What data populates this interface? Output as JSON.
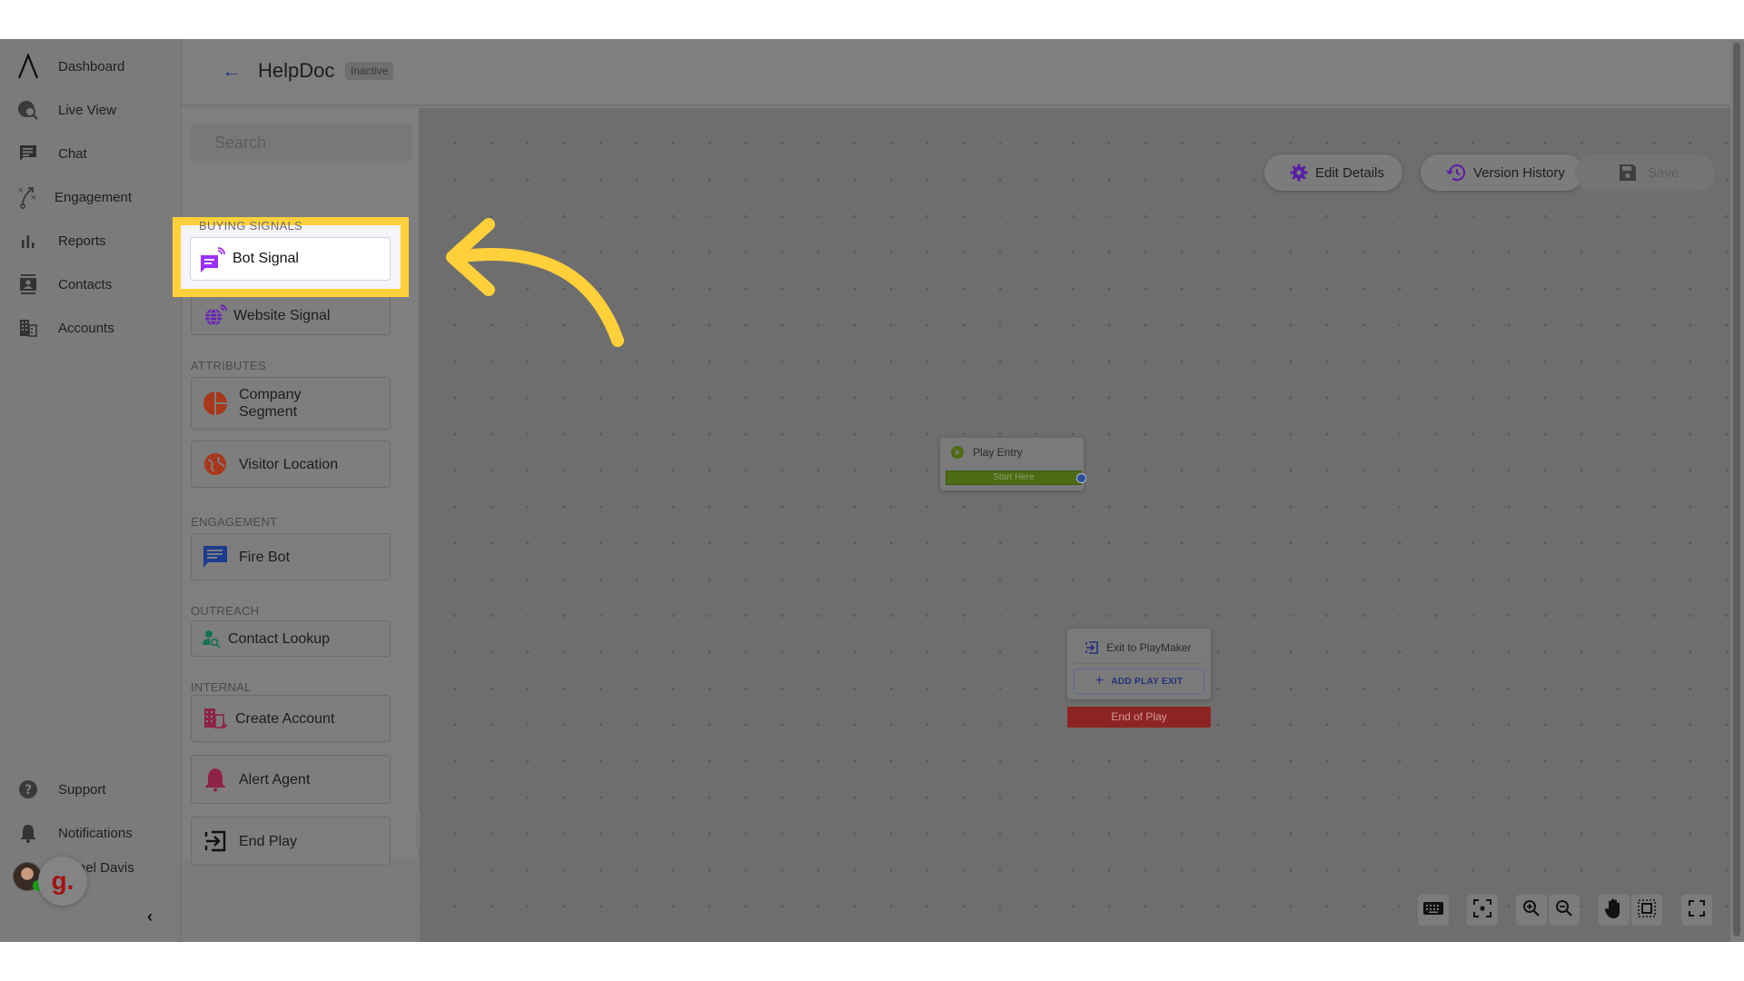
{
  "nav": {
    "items": [
      {
        "label": "Dashboard",
        "icon": "logo-caret-icon"
      },
      {
        "label": "Live View",
        "icon": "globe-search-icon"
      },
      {
        "label": "Chat",
        "icon": "chat-icon"
      },
      {
        "label": "Engagement",
        "icon": "strategy-icon"
      },
      {
        "label": "Reports",
        "icon": "bar-chart-icon"
      },
      {
        "label": "Contacts",
        "icon": "contact-card-icon"
      },
      {
        "label": "Accounts",
        "icon": "building-icon"
      }
    ],
    "bottom_items": [
      {
        "label": "Support",
        "icon": "help-icon"
      },
      {
        "label": "Notifications",
        "icon": "bell-icon"
      }
    ],
    "user_name": "Michael Davis",
    "user_name_visible": "ael Davis",
    "g_badge": "g.",
    "collapse_icon": "chevron-left-icon"
  },
  "header": {
    "back_icon": "arrow-left-icon",
    "title": "HelpDoc",
    "status_badge": "Inactive"
  },
  "palette": {
    "search_placeholder": "Search",
    "sections": [
      {
        "label": "BUYING SIGNALS",
        "items": [
          {
            "label": "Bot Signal",
            "icon": "bot-signal-icon",
            "color": "#9b30ff",
            "highlighted": true
          },
          {
            "label": "Website Signal",
            "icon": "website-signal-icon",
            "color": "#6a22b8"
          }
        ]
      },
      {
        "label": "ATTRIBUTES",
        "items": [
          {
            "label": "Company Segment",
            "icon": "pie-segment-icon",
            "color": "#a8371b"
          },
          {
            "label": "Visitor Location",
            "icon": "globe-icon",
            "color": "#a8371b"
          }
        ]
      },
      {
        "label": "ENGAGEMENT",
        "items": [
          {
            "label": "Fire Bot",
            "icon": "chat-icon",
            "color": "#1d3b8f"
          }
        ]
      },
      {
        "label": "OUTREACH",
        "items": [
          {
            "label": "Contact Lookup",
            "icon": "person-search-icon",
            "color": "#16714e"
          }
        ]
      },
      {
        "label": "INTERNAL",
        "items": [
          {
            "label": "Create Account",
            "icon": "building-add-icon",
            "color": "#8f2248"
          },
          {
            "label": "Alert Agent",
            "icon": "bell-icon",
            "color": "#8f2248"
          },
          {
            "label": "End Play",
            "icon": "exit-icon",
            "color": "#111111"
          }
        ]
      }
    ]
  },
  "toolbar": {
    "edit_details": "Edit Details",
    "version_history": "Version History",
    "save": "Save"
  },
  "canvas": {
    "play_entry": {
      "title": "Play Entry",
      "start_label": "Start Here"
    },
    "exit_node": {
      "title": "Exit to PlayMaker",
      "add_exit_label": "ADD PLAY EXIT",
      "end_label": "End of Play"
    },
    "controls": [
      "keyboard-icon",
      "fit-view-icon",
      "zoom-in-icon",
      "zoom-out-icon",
      "hand-pan-icon",
      "select-area-icon",
      "fullscreen-icon"
    ]
  },
  "colors": {
    "highlight": "#ffd03a",
    "accent_purple": "#6a22b8",
    "start_green": "#4d6a14",
    "end_red": "#8e2323"
  }
}
